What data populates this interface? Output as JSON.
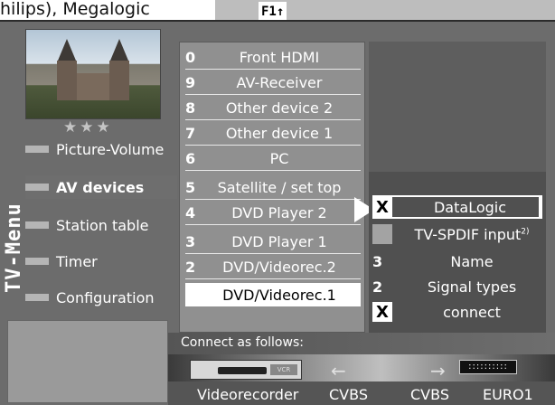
{
  "caption": {
    "text": "hilips), Megalogic"
  },
  "nav_hint": {
    "label": "F1↑"
  },
  "brand": {
    "text": "TV-Menu"
  },
  "preview": {
    "stars": "★★★"
  },
  "main_menu": [
    {
      "label": "Picture-Volume",
      "active": false
    },
    {
      "label": "AV devices",
      "active": true
    },
    {
      "label": "Station table",
      "active": false
    },
    {
      "label": "Timer",
      "active": false
    },
    {
      "label": "Configuration",
      "active": false
    }
  ],
  "devices": [
    {
      "num": "0",
      "name": "Front HDMI"
    },
    {
      "num": "9",
      "name": "AV-Receiver"
    },
    {
      "num": "8",
      "name": "Other device 2"
    },
    {
      "num": "7",
      "name": "Other device 1"
    },
    {
      "num": "6",
      "name": "PC"
    },
    {
      "num": "5",
      "name": "Satellite / set top"
    },
    {
      "num": "4",
      "name": "DVD Player 2"
    },
    {
      "num": "3",
      "name": "DVD Player 1"
    },
    {
      "num": "2",
      "name": "DVD/Videorec.2"
    },
    {
      "num": "",
      "name": "DVD/Videorec.1"
    }
  ],
  "options": [
    {
      "marker": "X",
      "text": "DataLogic"
    },
    {
      "marker": "",
      "text": "TV-SPDIF input",
      "superscript": "2)"
    },
    {
      "marker": "3",
      "text": "Name"
    },
    {
      "marker": "2",
      "text": "Signal types"
    },
    {
      "marker": "X",
      "text": "connect"
    }
  ],
  "connect": {
    "heading": "Connect as follows:",
    "left_arrow": "←",
    "right_arrow": "→",
    "vcr_tag": "VCR",
    "scart_text": "::::::::::",
    "device_label": "Videorecorder",
    "signal_left": "CVBS",
    "signal_right": "CVBS",
    "socket_label": "EURO1"
  },
  "colors": {
    "panel_background": "#6c6c6c",
    "selection": "#ffffff",
    "text": "#ffffff"
  }
}
